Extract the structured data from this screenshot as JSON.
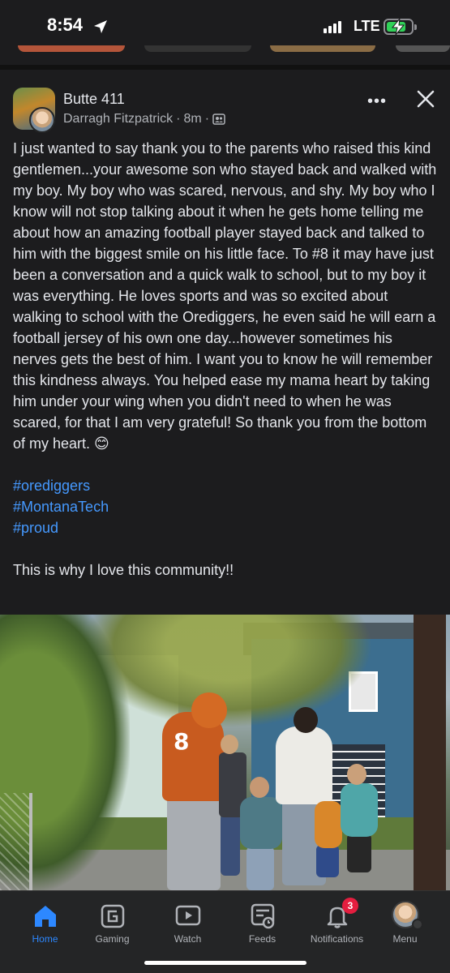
{
  "status_bar": {
    "time": "8:54",
    "network": "LTE",
    "battery_level": 0.7
  },
  "post": {
    "group_name": "Butte 411",
    "author": "Darragh Fitzpatrick",
    "timestamp": "8m",
    "separator": "·",
    "paragraphs": [
      "I just wanted to say thank you to the parents who raised this kind gentlemen...your awesome son who stayed back and walked with my boy. My boy who was scared, nervous, and shy. My boy who I know will not stop talking about it when he gets home telling me about how an amazing football player stayed back and talked to him with the biggest smile on his little face. To #8 it may have just been a conversation and a quick walk to school, but to my boy it was everything.  He loves sports and was so excited about walking to school with the Orediggers, he even said he will earn a football jersey of his own one day...however sometimes his nerves gets the best of him. I want you to know he will remember this kindness always. You helped ease my mama heart by taking him under your wing when you didn't need to when he was scared, for that I am very grateful! So thank you from the bottom of my heart. 😊"
    ],
    "hashtags": [
      "#orediggers",
      "#MontanaTech",
      "#proud"
    ],
    "closing": "This is why I love this community!!",
    "photo_jersey_number": "8"
  },
  "tab_bar": {
    "tabs": [
      {
        "label": "Home",
        "icon": "home-icon",
        "active": true
      },
      {
        "label": "Gaming",
        "icon": "gaming-icon"
      },
      {
        "label": "Watch",
        "icon": "watch-icon"
      },
      {
        "label": "Feeds",
        "icon": "feeds-icon"
      },
      {
        "label": "Notifications",
        "icon": "bell-icon",
        "badge": "3"
      },
      {
        "label": "Menu",
        "icon": "profile-avatar"
      }
    ]
  },
  "colors": {
    "background": "#1c1c1e",
    "accent": "#2d88ff",
    "hashtag": "#4599ff",
    "badge": "#e41e3f"
  }
}
